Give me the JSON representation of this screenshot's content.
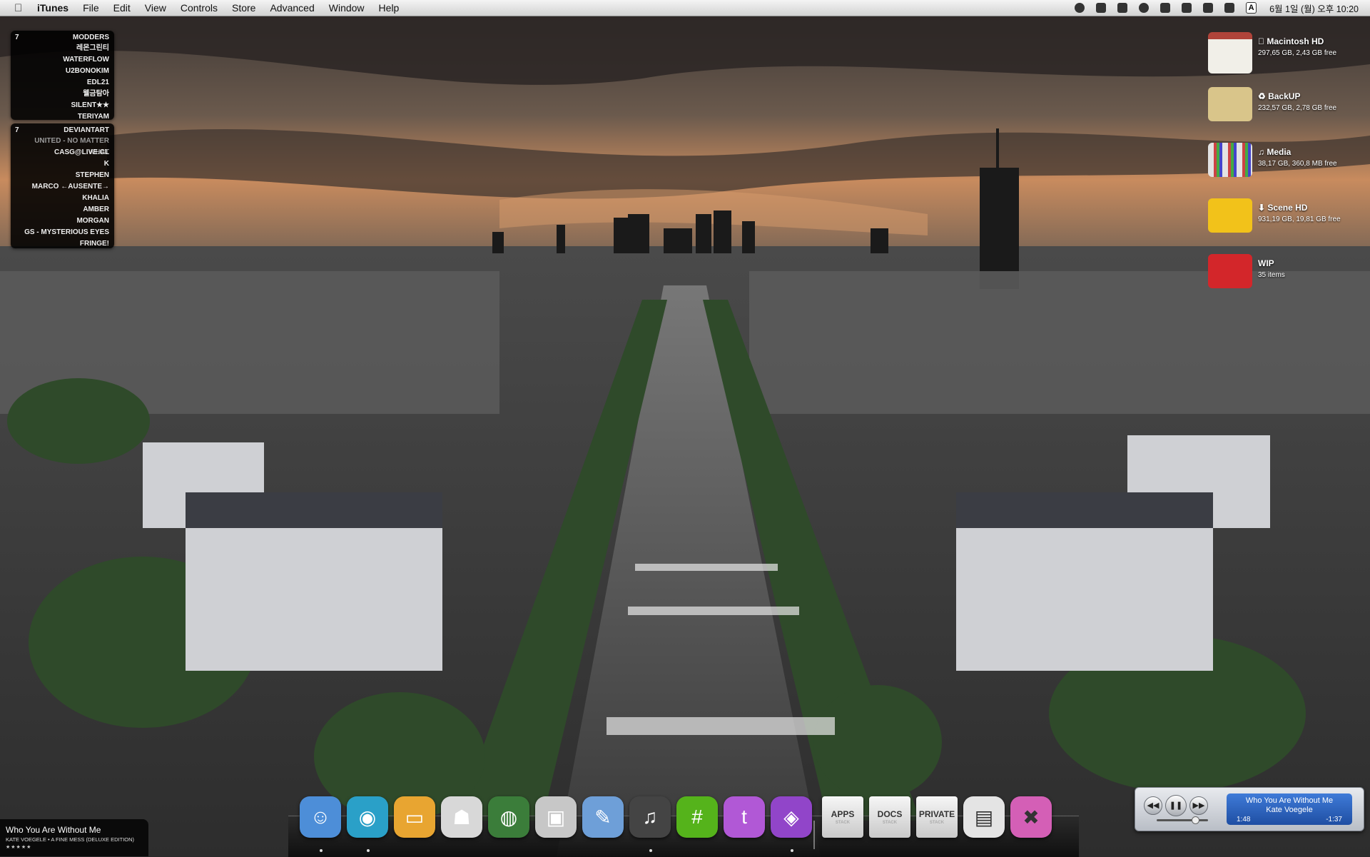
{
  "menubar": {
    "app_name": "iTunes",
    "items": [
      "File",
      "Edit",
      "View",
      "Controls",
      "Store",
      "Advanced",
      "Window",
      "Help"
    ],
    "clock": "6월 1일 (월)  오후 10:20",
    "status_icons": [
      "bluetooth-icon",
      "display-icon",
      "spotlight-like-icon",
      "time-machine-icon",
      "spaces-icon",
      "screen-icon",
      "wifi-icon",
      "volume-icon",
      "input-source-icon"
    ],
    "input_source": "A"
  },
  "widgets": {
    "modders": {
      "count": "7",
      "title": "MODDERS",
      "rows": [
        "레몬그린티",
        "WATERFLOW",
        "U2BONOKIM",
        "EDL21",
        "웰금탐아",
        "SILENT★★",
        "TERIYAM"
      ]
    },
    "deviantart": {
      "count": "7",
      "title": "DEVIANTART",
      "rows": [
        "UNITED - NO MATTER WHAT",
        "CASG@LIVE.CL",
        "K",
        "STEPHEN",
        "MARCO ←AUSENTE→",
        "KHALIA",
        "AMBER",
        "MORGAN",
        "GS - MYSTERIOUS EYES",
        "FRINGE!"
      ]
    }
  },
  "drives": [
    {
      "name": "Macintosh HD",
      "info": "297,65 GB, 2,43 GB free",
      "prefix": "",
      "color": "#f1efe8"
    },
    {
      "name": "BackUP",
      "info": "232,57 GB, 2,78 GB free",
      "prefix": "♻ ",
      "color": "#d9c58a"
    },
    {
      "name": "Media",
      "info": "38,17 GB, 360,8 MB free",
      "prefix": "♫ ",
      "color": "#cfcfcf"
    },
    {
      "name": "Scene HD",
      "info": "931,19 GB, 19,81 GB free",
      "prefix": "⬇ ",
      "color": "#f2c21a"
    },
    {
      "name": "WIP",
      "info": "35 items",
      "prefix": "",
      "color": "#d3262a"
    }
  ],
  "dock": {
    "apps": [
      {
        "name": "finder-icon",
        "color": "#4d8ed8",
        "glyph": "☺"
      },
      {
        "name": "chat-app-icon",
        "color": "#2aa0c8",
        "glyph": "◉"
      },
      {
        "name": "folder-app-icon",
        "color": "#e8a531",
        "glyph": "▭"
      },
      {
        "name": "stormtrooper-icon",
        "color": "#d8d8d8",
        "glyph": "☗"
      },
      {
        "name": "globe-icon",
        "color": "#3b7d3a",
        "glyph": "◍"
      },
      {
        "name": "delivery-truck-icon",
        "color": "#c7c7c7",
        "glyph": "▣"
      },
      {
        "name": "document-edit-icon",
        "color": "#6e9fd8",
        "glyph": "✎"
      },
      {
        "name": "headphones-icon",
        "color": "#444444",
        "glyph": "♫"
      },
      {
        "name": "hashtag-chat-icon",
        "color": "#55b31b",
        "glyph": "#"
      },
      {
        "name": "twitter-t-icon",
        "color": "#b158d6",
        "glyph": "t"
      },
      {
        "name": "itunes-disc-icon",
        "color": "#9145c9",
        "glyph": "◈"
      }
    ],
    "stacks": [
      {
        "label": "APPS",
        "sub": "STACK"
      },
      {
        "label": "DOCS",
        "sub": "STACK"
      },
      {
        "label": "PRIVATE",
        "sub": "STACK"
      }
    ],
    "extras": [
      {
        "name": "downloads-icon",
        "color": "#e4e4e4",
        "glyph": "▤"
      },
      {
        "name": "trash-icon",
        "color": "#d45fb6",
        "glyph": "✖"
      }
    ]
  },
  "now_playing": {
    "title": "Who You Are Without Me",
    "subtitle": "KATE VOEGELE • A FINE MESS (DELUXE EDITION)",
    "stars": "★★★★★"
  },
  "mini_player": {
    "song": "Who You Are Without Me",
    "artist": "Kate Voegele",
    "elapsed": "1:48",
    "remaining": "-1:37",
    "volume": 0.75
  }
}
